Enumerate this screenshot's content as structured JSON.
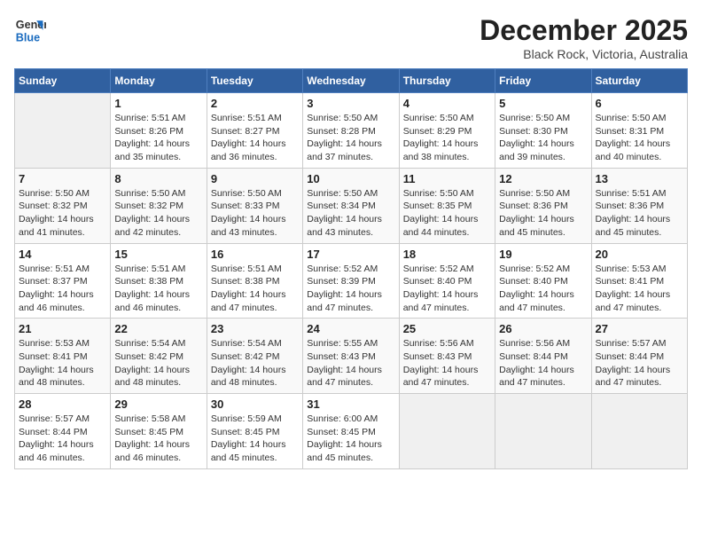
{
  "logo": {
    "line1": "General",
    "line2": "Blue"
  },
  "title": "December 2025",
  "location": "Black Rock, Victoria, Australia",
  "days_header": [
    "Sunday",
    "Monday",
    "Tuesday",
    "Wednesday",
    "Thursday",
    "Friday",
    "Saturday"
  ],
  "weeks": [
    [
      {
        "day": "",
        "info": ""
      },
      {
        "day": "1",
        "info": "Sunrise: 5:51 AM\nSunset: 8:26 PM\nDaylight: 14 hours\nand 35 minutes."
      },
      {
        "day": "2",
        "info": "Sunrise: 5:51 AM\nSunset: 8:27 PM\nDaylight: 14 hours\nand 36 minutes."
      },
      {
        "day": "3",
        "info": "Sunrise: 5:50 AM\nSunset: 8:28 PM\nDaylight: 14 hours\nand 37 minutes."
      },
      {
        "day": "4",
        "info": "Sunrise: 5:50 AM\nSunset: 8:29 PM\nDaylight: 14 hours\nand 38 minutes."
      },
      {
        "day": "5",
        "info": "Sunrise: 5:50 AM\nSunset: 8:30 PM\nDaylight: 14 hours\nand 39 minutes."
      },
      {
        "day": "6",
        "info": "Sunrise: 5:50 AM\nSunset: 8:31 PM\nDaylight: 14 hours\nand 40 minutes."
      }
    ],
    [
      {
        "day": "7",
        "info": "Sunrise: 5:50 AM\nSunset: 8:32 PM\nDaylight: 14 hours\nand 41 minutes."
      },
      {
        "day": "8",
        "info": "Sunrise: 5:50 AM\nSunset: 8:32 PM\nDaylight: 14 hours\nand 42 minutes."
      },
      {
        "day": "9",
        "info": "Sunrise: 5:50 AM\nSunset: 8:33 PM\nDaylight: 14 hours\nand 43 minutes."
      },
      {
        "day": "10",
        "info": "Sunrise: 5:50 AM\nSunset: 8:34 PM\nDaylight: 14 hours\nand 43 minutes."
      },
      {
        "day": "11",
        "info": "Sunrise: 5:50 AM\nSunset: 8:35 PM\nDaylight: 14 hours\nand 44 minutes."
      },
      {
        "day": "12",
        "info": "Sunrise: 5:50 AM\nSunset: 8:36 PM\nDaylight: 14 hours\nand 45 minutes."
      },
      {
        "day": "13",
        "info": "Sunrise: 5:51 AM\nSunset: 8:36 PM\nDaylight: 14 hours\nand 45 minutes."
      }
    ],
    [
      {
        "day": "14",
        "info": "Sunrise: 5:51 AM\nSunset: 8:37 PM\nDaylight: 14 hours\nand 46 minutes."
      },
      {
        "day": "15",
        "info": "Sunrise: 5:51 AM\nSunset: 8:38 PM\nDaylight: 14 hours\nand 46 minutes."
      },
      {
        "day": "16",
        "info": "Sunrise: 5:51 AM\nSunset: 8:38 PM\nDaylight: 14 hours\nand 47 minutes."
      },
      {
        "day": "17",
        "info": "Sunrise: 5:52 AM\nSunset: 8:39 PM\nDaylight: 14 hours\nand 47 minutes."
      },
      {
        "day": "18",
        "info": "Sunrise: 5:52 AM\nSunset: 8:40 PM\nDaylight: 14 hours\nand 47 minutes."
      },
      {
        "day": "19",
        "info": "Sunrise: 5:52 AM\nSunset: 8:40 PM\nDaylight: 14 hours\nand 47 minutes."
      },
      {
        "day": "20",
        "info": "Sunrise: 5:53 AM\nSunset: 8:41 PM\nDaylight: 14 hours\nand 47 minutes."
      }
    ],
    [
      {
        "day": "21",
        "info": "Sunrise: 5:53 AM\nSunset: 8:41 PM\nDaylight: 14 hours\nand 48 minutes."
      },
      {
        "day": "22",
        "info": "Sunrise: 5:54 AM\nSunset: 8:42 PM\nDaylight: 14 hours\nand 48 minutes."
      },
      {
        "day": "23",
        "info": "Sunrise: 5:54 AM\nSunset: 8:42 PM\nDaylight: 14 hours\nand 48 minutes."
      },
      {
        "day": "24",
        "info": "Sunrise: 5:55 AM\nSunset: 8:43 PM\nDaylight: 14 hours\nand 47 minutes."
      },
      {
        "day": "25",
        "info": "Sunrise: 5:56 AM\nSunset: 8:43 PM\nDaylight: 14 hours\nand 47 minutes."
      },
      {
        "day": "26",
        "info": "Sunrise: 5:56 AM\nSunset: 8:44 PM\nDaylight: 14 hours\nand 47 minutes."
      },
      {
        "day": "27",
        "info": "Sunrise: 5:57 AM\nSunset: 8:44 PM\nDaylight: 14 hours\nand 47 minutes."
      }
    ],
    [
      {
        "day": "28",
        "info": "Sunrise: 5:57 AM\nSunset: 8:44 PM\nDaylight: 14 hours\nand 46 minutes."
      },
      {
        "day": "29",
        "info": "Sunrise: 5:58 AM\nSunset: 8:45 PM\nDaylight: 14 hours\nand 46 minutes."
      },
      {
        "day": "30",
        "info": "Sunrise: 5:59 AM\nSunset: 8:45 PM\nDaylight: 14 hours\nand 45 minutes."
      },
      {
        "day": "31",
        "info": "Sunrise: 6:00 AM\nSunset: 8:45 PM\nDaylight: 14 hours\nand 45 minutes."
      },
      {
        "day": "",
        "info": ""
      },
      {
        "day": "",
        "info": ""
      },
      {
        "day": "",
        "info": ""
      }
    ]
  ]
}
